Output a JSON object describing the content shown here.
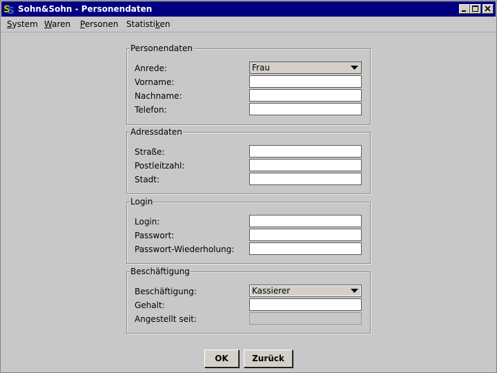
{
  "window": {
    "title": "Sohn&Sohn - Personendaten",
    "icon": "app-logo-icon",
    "title_color": "#000080",
    "controls": [
      "minimize-icon",
      "maximize-icon",
      "close-icon"
    ]
  },
  "menu": {
    "items": [
      {
        "label": "System",
        "mnemonic": "S"
      },
      {
        "label": "Waren",
        "mnemonic": "W"
      },
      {
        "label": "Personen",
        "mnemonic": "P"
      },
      {
        "label": "Statistiken",
        "mnemonic": "k"
      }
    ]
  },
  "personendaten": {
    "title": "Personendaten",
    "anrede_label": "Anrede:",
    "anrede_value": "Frau",
    "vorname_label": "Vorname:",
    "vorname_value": "",
    "nachname_label": "Nachname:",
    "nachname_value": "",
    "telefon_label": "Telefon:",
    "telefon_value": ""
  },
  "adressdaten": {
    "title": "Adressdaten",
    "strasse_label": "Straße:",
    "strasse_value": "",
    "plz_label": "Postleitzahl:",
    "plz_value": "",
    "stadt_label": "Stadt:",
    "stadt_value": ""
  },
  "login": {
    "title": "Login",
    "login_label": "Login:",
    "login_value": "",
    "passwort_label": "Passwort:",
    "passwort_value": "",
    "passwort2_label": "Passwort-Wiederholung:",
    "passwort2_value": ""
  },
  "beschaeftigung": {
    "title": "Beschäftigung",
    "beschaeftigung_label": "Beschäftigung:",
    "beschaeftigung_value": "Kassierer",
    "gehalt_label": "Gehalt:",
    "gehalt_value": "",
    "angestellt_label": "Angestellt seit:",
    "angestellt_value": ""
  },
  "buttons": {
    "ok_label": "OK",
    "back_label": "Zurück"
  }
}
